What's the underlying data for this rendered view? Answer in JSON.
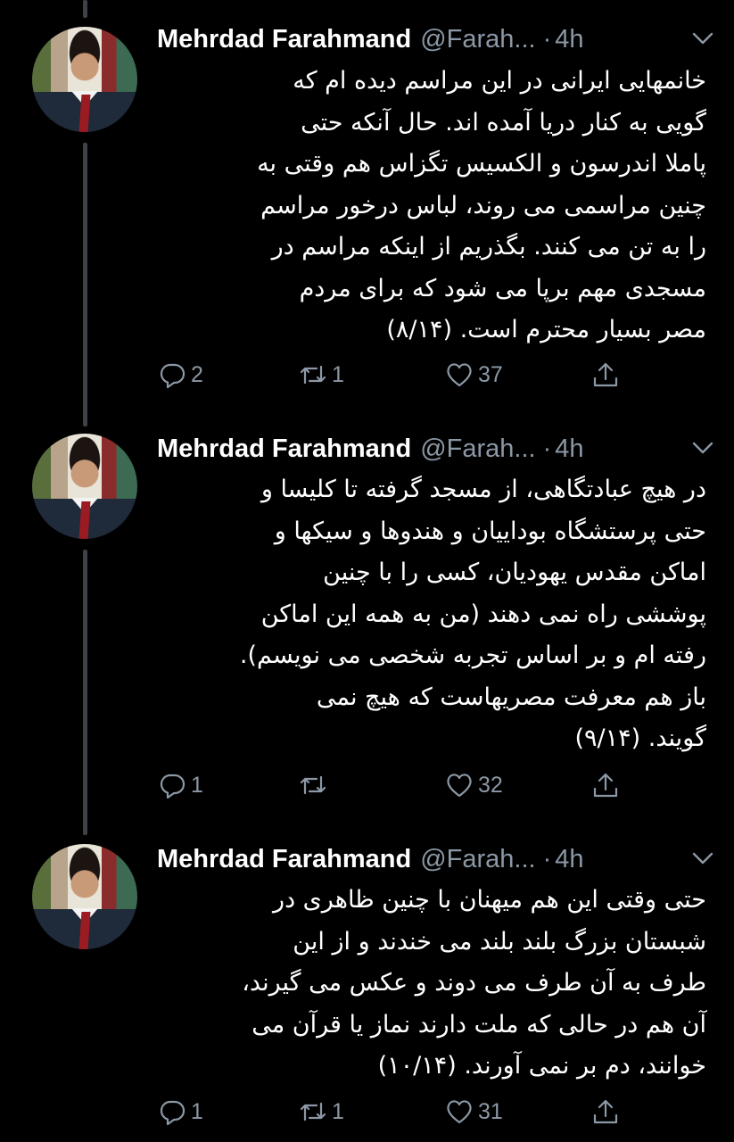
{
  "colors": {
    "background": "#000000",
    "text": "#ffffff",
    "secondary": "#8b98a5",
    "thread_line": "#3d4148"
  },
  "tweets": [
    {
      "name": "Mehrdad Farahmand",
      "handle": "@Farah...",
      "dot": "·",
      "time": "4h",
      "lines": [
        "خانمهایی ایرانی در این مراسم دیده ام که",
        "گویی به کنار دریا آمده اند. حال آنکه حتی",
        "پاملا اندرسون و الکسیس تگزاس هم وقتی به",
        "چنین مراسمی می روند، لباس درخور مراسم",
        "را به تن می کنند. بگذریم از اینکه مراسم در",
        "مسجدی مهم برپا می شود که برای مردم",
        "مصر بسیار محترم است. (۸/۱۴)"
      ],
      "replies": "2",
      "retweets": "1",
      "likes": "37"
    },
    {
      "name": "Mehrdad Farahmand",
      "handle": "@Farah...",
      "dot": "·",
      "time": "4h",
      "lines": [
        "در هیچ عبادتگاهی، از مسجد گرفته تا کلیسا و",
        "حتی پرستشگاه بوداییان و هندوها و سیکها و",
        "اماکن مقدس یهودیان، کسی را با چنین",
        "پوششی راه نمی دهند (من به همه این اماکن",
        "رفته ام و بر اساس تجربه شخصی می نویسم).",
        "باز هم معرفت مصریهاست که هیچ نمی",
        "گویند. (۹/۱۴)"
      ],
      "replies": "1",
      "retweets": "",
      "likes": "32"
    },
    {
      "name": "Mehrdad Farahmand",
      "handle": "@Farah...",
      "dot": "·",
      "time": "4h",
      "lines": [
        "حتی وقتی این هم میهنان با چنین ظاهری در",
        "شبستان بزرگ بلند بلند می خندند و از این",
        "طرف به آن طرف می دوند و عکس می گیرند،",
        "آن هم در حالی که ملت دارند نماز یا قرآن می",
        "خوانند، دم بر نمی آورند. (۱۰/۱۴)"
      ],
      "replies": "1",
      "retweets": "1",
      "likes": "31"
    }
  ]
}
